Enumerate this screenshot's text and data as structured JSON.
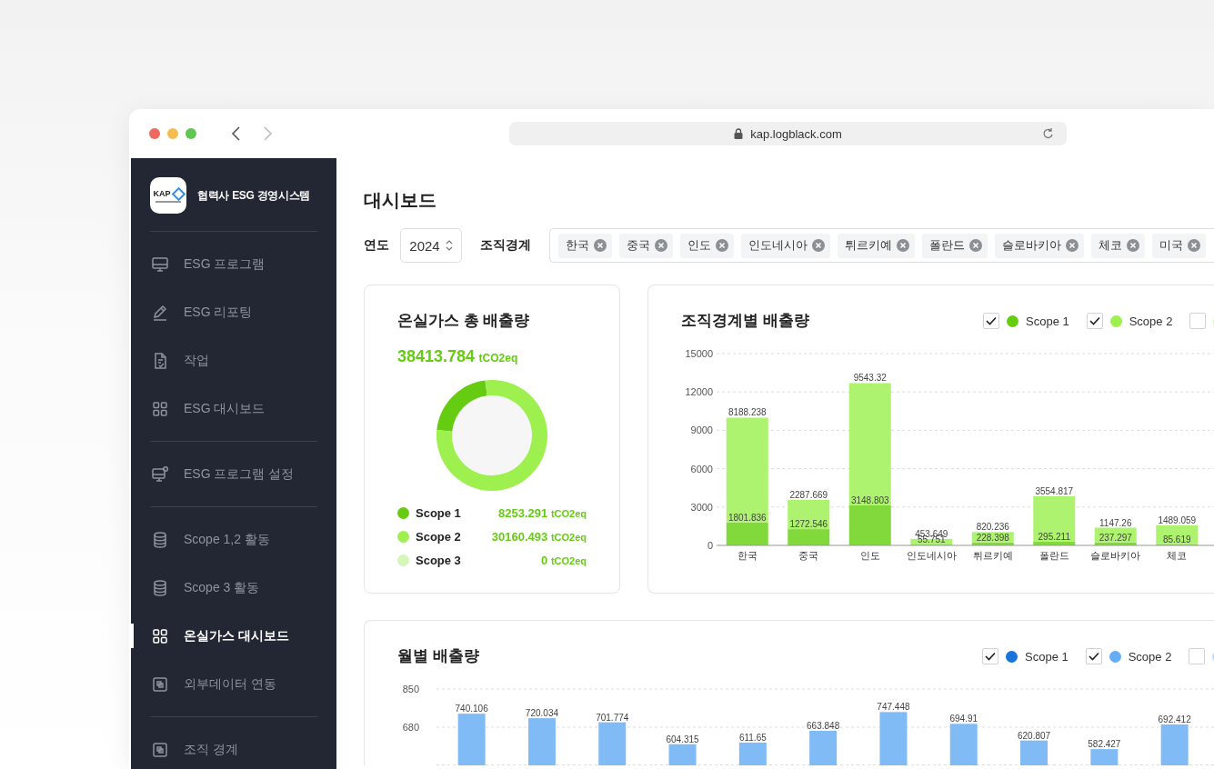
{
  "browser": {
    "url": "kap.logblack.com"
  },
  "sidebar": {
    "brand": {
      "logo_text": "KAP",
      "title": "협력사 ESG 경영시스템"
    },
    "groups": [
      {
        "items": [
          {
            "label": "ESG 프로그램",
            "kind": "monitor",
            "selected": false
          },
          {
            "label": "ESG 리포팅",
            "kind": "pen",
            "selected": false
          },
          {
            "label": "작업",
            "kind": "document",
            "selected": false
          },
          {
            "label": "ESG 대시보드",
            "kind": "grid",
            "selected": false
          }
        ]
      },
      {
        "items": [
          {
            "label": "ESG 프로그램 설정",
            "kind": "monitor-gear",
            "selected": false
          }
        ]
      },
      {
        "items": [
          {
            "label": "Scope 1,2 활동",
            "kind": "database",
            "selected": false
          },
          {
            "label": "Scope 3 활동",
            "kind": "database",
            "selected": false
          },
          {
            "label": "온실가스 대시보드",
            "kind": "grid",
            "selected": true
          },
          {
            "label": "외부데이터 연동",
            "kind": "linked-box",
            "selected": false
          }
        ]
      },
      {
        "items": [
          {
            "label": "조직 경계",
            "kind": "linked-box",
            "selected": false
          }
        ]
      }
    ]
  },
  "page": {
    "title": "대시보드"
  },
  "filters": {
    "year_label": "연도",
    "year": "2024",
    "org_label": "조직경계",
    "org_tags": [
      "한국",
      "중국",
      "인도",
      "인도네시아",
      "튀르키예",
      "폴란드",
      "슬로바키아",
      "체코",
      "미국"
    ]
  },
  "total_card": {
    "title": "온실가스 총 배출량",
    "total": "38413.784",
    "unit": "tCO2eq",
    "legend": [
      {
        "label": "Scope 1",
        "value": "8253.291",
        "unit": "tCO2eq",
        "color": "#66cc11"
      },
      {
        "label": "Scope 2",
        "value": "30160.493",
        "unit": "tCO2eq",
        "color": "#9ef04f"
      },
      {
        "label": "Scope 3",
        "value": "0",
        "unit": "tCO2eq",
        "color": "#d4f7b8"
      }
    ],
    "chart_data": {
      "type": "donut",
      "values": [
        21.49,
        78.51,
        0
      ]
    }
  },
  "bar_cards": [
    {
      "title": "조직경계별 배출량",
      "legend": [
        {
          "label": "Scope 1",
          "checked": true,
          "color": "#66cc11"
        },
        {
          "label": "Scope 2",
          "checked": true,
          "color": "#9ef04f"
        },
        {
          "checked": false,
          "color": "#d4f7b8"
        }
      ],
      "chart_data": {
        "type": "bar",
        "stacked": true,
        "data_labels": true,
        "grid": true,
        "categories": [
          "한국",
          "중국",
          "인도",
          "인도네시아",
          "튀르키예",
          "폴란드",
          "슬로바키아",
          "체코"
        ],
        "ylim": [
          0,
          15000
        ],
        "yticks": [
          0,
          3000,
          6000,
          9000,
          12000,
          15000
        ],
        "series": [
          {
            "color": "#82d93b",
            "values": [
              1801.836,
              1272.546,
              3148.803,
              55.751,
              228.398,
              295.211,
              237.297,
              85.619
            ]
          },
          {
            "color": "#adf36f",
            "values": [
              8188.238,
              2287.669,
              9543.32,
              453.649,
              820.236,
              3554.817,
              1147.26,
              1489.059
            ]
          }
        ]
      }
    },
    {
      "title": "월별 배출량",
      "legend": [
        {
          "label": "Scope 1",
          "checked": true,
          "color": "#1a73d9"
        },
        {
          "label": "Scope 2",
          "checked": true,
          "color": "#66adf5"
        },
        {
          "checked": false,
          "color": "#bcdcfb"
        }
      ],
      "chart_data": {
        "type": "bar",
        "data_labels": true,
        "grid": true,
        "ylim": [
          510,
          850
        ],
        "yticks": [
          680,
          850
        ],
        "series": [
          {
            "color": "#80bbf5",
            "values": [
              740.106,
              720.034,
              701.774,
              604.315,
              611.65,
              663.848,
              747.448,
              694.91,
              620.807,
              582.427,
              692.412
            ]
          }
        ]
      }
    }
  ]
}
